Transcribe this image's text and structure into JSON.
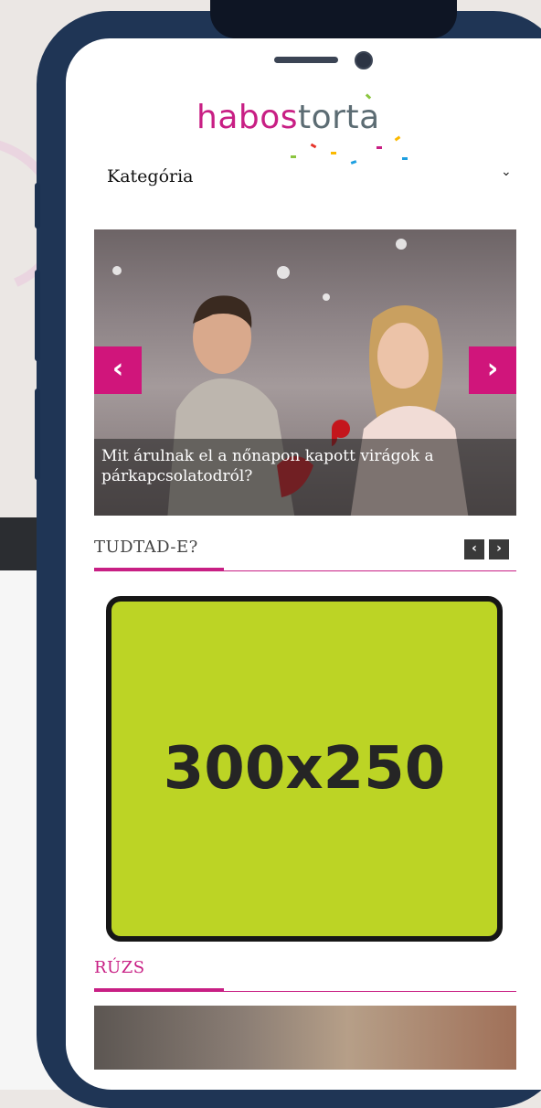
{
  "header": {
    "logo_part1": "habos",
    "logo_part2": "torta",
    "category_label": "Kategória",
    "category_chevron": "⌄"
  },
  "slider": {
    "caption": "Mit árulnak el a nőnapon kapott virágok a párkapcsolatodról?",
    "prev": "‹",
    "next": "›"
  },
  "sections": [
    {
      "title": "TUDTAD-E?",
      "prev": "‹",
      "next": "›"
    },
    {
      "title": "RÚZS"
    }
  ],
  "ad": {
    "label": "300x250"
  },
  "colors": {
    "accent": "#c81f84",
    "ad_bg": "#bcd425",
    "phone_frame": "#1f3555"
  }
}
